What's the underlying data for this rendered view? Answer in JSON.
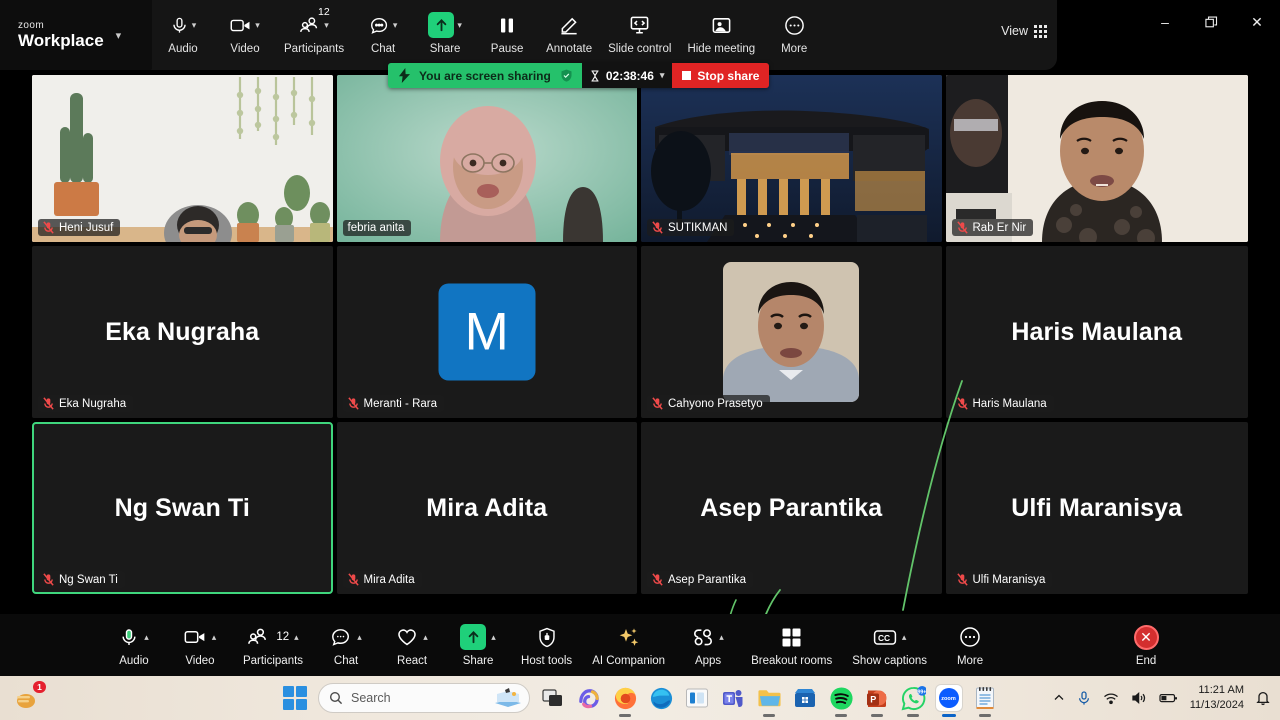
{
  "app": {
    "brand_small": "zoom",
    "brand_large": "Workplace",
    "view_label": "View"
  },
  "top_toolbar": {
    "items": [
      {
        "label": "Audio",
        "icon": "microphone-icon",
        "caret": true,
        "badge": ""
      },
      {
        "label": "Video",
        "icon": "camera-icon",
        "caret": true,
        "badge": ""
      },
      {
        "label": "Participants",
        "icon": "participants-icon",
        "caret": true,
        "badge": "12"
      },
      {
        "label": "Chat",
        "icon": "chat-bubble-icon",
        "caret": true,
        "badge": ""
      },
      {
        "label": "Share",
        "icon": "share-arrow-icon",
        "caret": true,
        "badge": ""
      },
      {
        "label": "Pause",
        "icon": "pause-icon",
        "caret": false,
        "badge": ""
      },
      {
        "label": "Annotate",
        "icon": "pencil-icon",
        "caret": false,
        "badge": ""
      },
      {
        "label": "Slide control",
        "icon": "slide-control-icon",
        "caret": false,
        "badge": ""
      },
      {
        "label": "Hide meeting",
        "icon": "hide-meeting-icon",
        "caret": false,
        "badge": ""
      },
      {
        "label": "More",
        "icon": "more-dots-icon",
        "caret": false,
        "badge": ""
      }
    ]
  },
  "window_controls": {
    "minimize": "–",
    "restore": "❐",
    "close": "✕"
  },
  "share_status": {
    "message": "You are screen sharing",
    "timer": "02:38:46",
    "stop_label": "Stop share",
    "green": "#25c16b",
    "red": "#e02424"
  },
  "gallery": {
    "rows": [
      [
        {
          "name": "Heni Jusuf",
          "display": "",
          "type": "video",
          "bg": "plants",
          "muted": true,
          "active": false
        },
        {
          "name": "febria anita",
          "display": "",
          "type": "video",
          "bg": "febria",
          "muted": false,
          "active": false
        },
        {
          "name": "SUTIKMAN",
          "display": "",
          "type": "video",
          "bg": "building",
          "muted": true,
          "active": false
        },
        {
          "name": "Rab Er Nir",
          "display": "",
          "type": "video",
          "bg": "room",
          "muted": true,
          "active": false
        }
      ],
      [
        {
          "name": "Eka Nugraha",
          "display": "Eka Nugraha",
          "type": "name",
          "muted": true,
          "active": false
        },
        {
          "name": "Meranti - Rara",
          "display": "M",
          "type": "letter",
          "muted": true,
          "active": false,
          "avatar_color": "#1175c2"
        },
        {
          "name": "Cahyono Prasetyo",
          "display": "",
          "type": "photo",
          "muted": true,
          "active": false
        },
        {
          "name": "Haris Maulana",
          "display": "Haris Maulana",
          "type": "name",
          "muted": true,
          "active": false
        }
      ],
      [
        {
          "name": "Ng Swan Ti",
          "display": "Ng Swan Ti",
          "type": "name",
          "muted": true,
          "active": true
        },
        {
          "name": "Mira Adita",
          "display": "Mira Adita",
          "type": "name",
          "muted": true,
          "active": false
        },
        {
          "name": "Asep Parantika",
          "display": "Asep Parantika",
          "type": "name",
          "muted": true,
          "active": false
        },
        {
          "name": "Ulfi Maranisya",
          "display": "Ulfi Maranisya",
          "type": "name",
          "muted": true,
          "active": false
        }
      ]
    ],
    "active_speaker_color": "#3fd67d"
  },
  "bottom_toolbar": {
    "items": [
      {
        "label": "Audio",
        "icon": "microphone-icon",
        "caret": true,
        "count": ""
      },
      {
        "label": "Video",
        "icon": "camera-icon",
        "caret": true,
        "count": ""
      },
      {
        "label": "Participants",
        "icon": "participants-icon",
        "caret": true,
        "count": "12"
      },
      {
        "label": "Chat",
        "icon": "chat-bubble-icon",
        "caret": true,
        "count": ""
      },
      {
        "label": "React",
        "icon": "heart-icon",
        "caret": true,
        "count": ""
      },
      {
        "label": "Share",
        "icon": "share-arrow-icon",
        "caret": true,
        "count": ""
      },
      {
        "label": "Host tools",
        "icon": "shield-icon",
        "caret": false,
        "count": ""
      },
      {
        "label": "AI Companion",
        "icon": "sparkle-icon",
        "caret": false,
        "count": ""
      },
      {
        "label": "Apps",
        "icon": "apps-icon",
        "caret": true,
        "count": ""
      },
      {
        "label": "Breakout rooms",
        "icon": "breakout-rooms-icon",
        "caret": false,
        "count": ""
      },
      {
        "label": "Show captions",
        "icon": "closed-caption-icon",
        "caret": true,
        "count": ""
      },
      {
        "label": "More",
        "icon": "more-dots-icon",
        "caret": false,
        "count": ""
      }
    ],
    "end_label": "End"
  },
  "taskbar": {
    "search_placeholder": "Search",
    "time": "11:21 AM",
    "date": "11/13/2024",
    "whatsapp_badge": "99+",
    "mail_badge": "1",
    "apps": [
      {
        "name": "copilot-icon",
        "running": false
      },
      {
        "name": "firefox-icon",
        "running": true
      },
      {
        "name": "edge-icon",
        "running": false
      },
      {
        "name": "media-app-icon",
        "running": false
      },
      {
        "name": "teams-icon",
        "running": false
      },
      {
        "name": "file-explorer-icon",
        "running": true
      },
      {
        "name": "microsoft-store-icon",
        "running": false
      },
      {
        "name": "spotify-icon",
        "running": true
      },
      {
        "name": "powerpoint-icon",
        "running": true
      }
    ]
  }
}
